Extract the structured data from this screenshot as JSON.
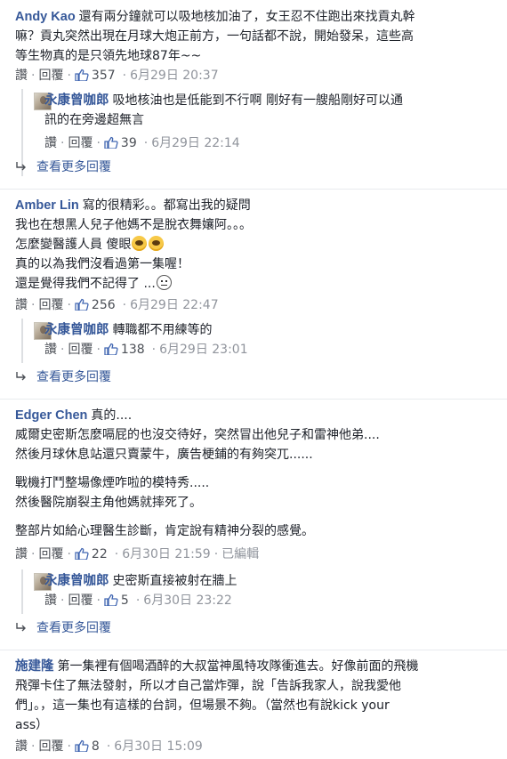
{
  "labels": {
    "like": "讚",
    "reply": "回覆",
    "edited": "已編輯",
    "see_more_replies": "查看更多回覆",
    "dot": "·"
  },
  "colors": {
    "author": "#365899",
    "meta": "#90949c",
    "text": "#1d2129",
    "like_icon": "#4267b2"
  },
  "threads": [
    {
      "author": "Andy Kao",
      "lines": [
        "還有兩分鐘就可以吸地核加油了，女王忍不住跑出來找貢丸幹",
        "嘛？貢丸突然出現在月球大炮正前方，一句話都不說，開始發呆，這些高",
        "等生物真的是只領先地球87年~~"
      ],
      "likes": "357",
      "time": "6月29日 20:37",
      "reply": {
        "author": "永康曾咖郎",
        "lines": [
          "吸地核油也是低能到不行啊 剛好有一艘船剛好可以通",
          "訊的在旁邊超無言"
        ],
        "likes": "39",
        "time": "6月29日 22:14"
      }
    },
    {
      "author": "Amber Lin",
      "lines": [
        "寫的很精彩。。都寫出我的疑問",
        "我也在想黑人兒子他媽不是脫衣舞孃阿。。。",
        "怎麼變醫護人員 傻眼",
        "真的以為我們沒看過第一集喔！",
        "還是覺得我們不記得了 ..."
      ],
      "likes": "256",
      "time": "6月29日 22:47",
      "reply": {
        "author": "永康曾咖郎",
        "lines": [
          "轉職都不用練等的"
        ],
        "likes": "138",
        "time": "6月29日 23:01"
      }
    },
    {
      "author": "Edger Chen",
      "lines": [
        "真的....",
        "威爾史密斯怎麼嗝屁的也沒交待好，突然冒出他兒子和雷神他弟....",
        "然後月球休息站還只賣蒙牛，廣告梗鋪的有夠突兀......",
        "",
        "戰機打鬥整場像煙咋啦的模特秀.....",
        "然後醫院崩裂主角他媽就摔死了。",
        "",
        "整部片如給心理醫生診斷，肯定說有精神分裂的感覺。"
      ],
      "likes": "22",
      "time": "6月30日 21:59",
      "reply": {
        "author": "永康曾咖郎",
        "lines": [
          "史密斯直接被射在牆上"
        ],
        "likes": "5",
        "time": "6月30日 23:22"
      }
    },
    {
      "author": "施建隆",
      "lines": [
        "第一集裡有個喝酒醉的大叔當神風特攻隊衝進去。好像前面的飛機",
        "飛彈卡住了無法發射，所以才自己當炸彈，說「告訴我家人，說我愛他",
        "們」。，這一集也有這樣的台詞，但場景不夠。（當然也有說kick your",
        "ass）"
      ],
      "likes": "8",
      "time": "6月30日 15:09"
    }
  ]
}
